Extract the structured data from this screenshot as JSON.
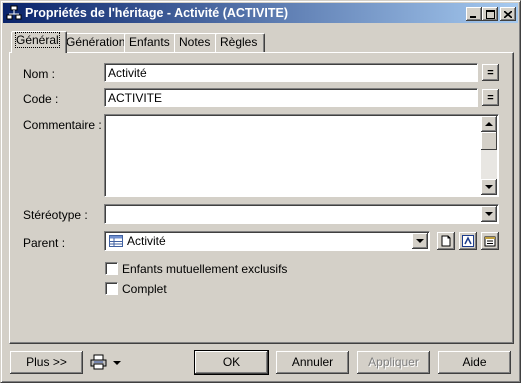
{
  "window": {
    "title": "Propriétés de l'héritage - Activité (ACTIVITE)"
  },
  "tabs": [
    {
      "label": "Général"
    },
    {
      "label": "Génération"
    },
    {
      "label": "Enfants"
    },
    {
      "label": "Notes"
    },
    {
      "label": "Règles"
    }
  ],
  "form": {
    "nom_label": "Nom :",
    "nom_value": "Activité",
    "code_label": "Code :",
    "code_value": "ACTIVITE",
    "equal_symbol": "=",
    "commentaire_label": "Commentaire :",
    "commentaire_value": "",
    "stereotype_label": "Stéréotype :",
    "stereotype_value": "",
    "parent_label": "Parent :",
    "parent_value": "Activité",
    "enfants_exclusifs_label": "Enfants mutuellement exclusifs",
    "enfants_exclusifs_checked": false,
    "complet_label": "Complet",
    "complet_checked": false
  },
  "footer": {
    "plus_label": "Plus >>",
    "ok_label": "OK",
    "annuler_label": "Annuler",
    "appliquer_label": "Appliquer",
    "aide_label": "Aide"
  },
  "colors": {
    "title_start": "#0a246a",
    "title_end": "#a6caf0",
    "face": "#d4d0c8"
  }
}
